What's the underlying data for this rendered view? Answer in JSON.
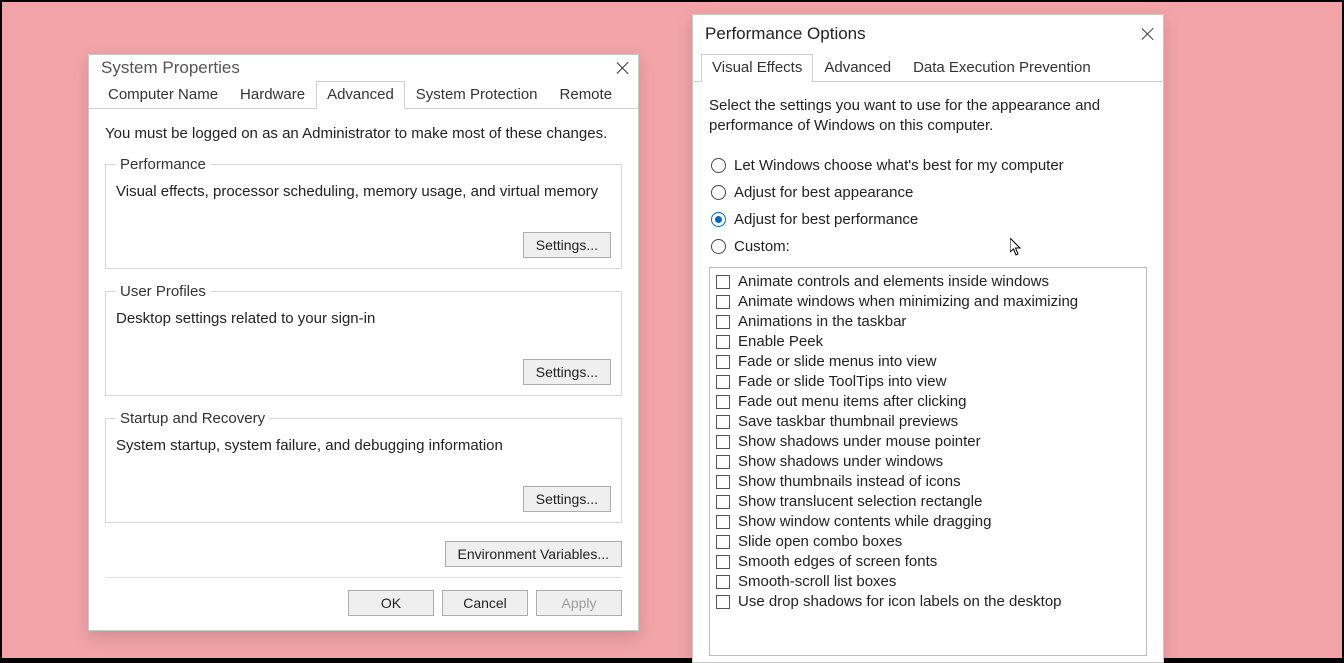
{
  "systemProperties": {
    "title": "System Properties",
    "tabs": [
      {
        "label": "Computer Name",
        "selected": false
      },
      {
        "label": "Hardware",
        "selected": false
      },
      {
        "label": "Advanced",
        "selected": true
      },
      {
        "label": "System Protection",
        "selected": false
      },
      {
        "label": "Remote",
        "selected": false
      }
    ],
    "admin_note": "You must be logged on as an Administrator to make most of these changes.",
    "groups": {
      "performance": {
        "legend": "Performance",
        "desc": "Visual effects, processor scheduling, memory usage, and virtual memory",
        "settings_btn": "Settings..."
      },
      "user_profiles": {
        "legend": "User Profiles",
        "desc": "Desktop settings related to your sign-in",
        "settings_btn": "Settings..."
      },
      "startup_recovery": {
        "legend": "Startup and Recovery",
        "desc": "System startup, system failure, and debugging information",
        "settings_btn": "Settings..."
      }
    },
    "env_btn": "Environment Variables...",
    "ok_btn": "OK",
    "cancel_btn": "Cancel",
    "apply_btn": "Apply"
  },
  "performanceOptions": {
    "title": "Performance Options",
    "tabs": [
      {
        "label": "Visual Effects",
        "selected": true
      },
      {
        "label": "Advanced",
        "selected": false
      },
      {
        "label": "Data Execution Prevention",
        "selected": false
      }
    ],
    "desc": "Select the settings you want to use for the appearance and performance of Windows on this computer.",
    "radios": [
      {
        "label": "Let Windows choose what's best for my computer",
        "selected": false
      },
      {
        "label": "Adjust for best appearance",
        "selected": false
      },
      {
        "label": "Adjust for best performance",
        "selected": true
      },
      {
        "label": "Custom:",
        "selected": false
      }
    ],
    "checks": [
      "Animate controls and elements inside windows",
      "Animate windows when minimizing and maximizing",
      "Animations in the taskbar",
      "Enable Peek",
      "Fade or slide menus into view",
      "Fade or slide ToolTips into view",
      "Fade out menu items after clicking",
      "Save taskbar thumbnail previews",
      "Show shadows under mouse pointer",
      "Show shadows under windows",
      "Show thumbnails instead of icons",
      "Show translucent selection rectangle",
      "Show window contents while dragging",
      "Slide open combo boxes",
      "Smooth edges of screen fonts",
      "Smooth-scroll list boxes",
      "Use drop shadows for icon labels on the desktop"
    ]
  }
}
